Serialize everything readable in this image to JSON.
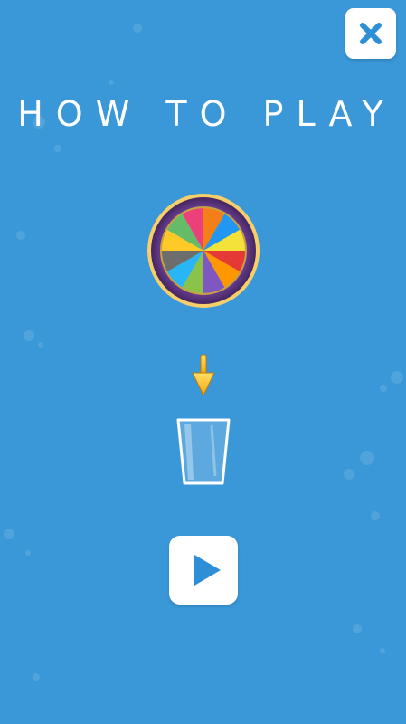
{
  "screen": {
    "title": "HOW TO PLAY"
  },
  "buttons": {
    "close_icon": "close-icon",
    "play_icon": "play-icon"
  },
  "illustration": {
    "wheel": "color-wheel",
    "arrow": "down-arrow",
    "cup": "cup"
  },
  "colors": {
    "background": "#3a97d8",
    "button_bg": "#ffffff",
    "icon": "#2f8fd6"
  }
}
